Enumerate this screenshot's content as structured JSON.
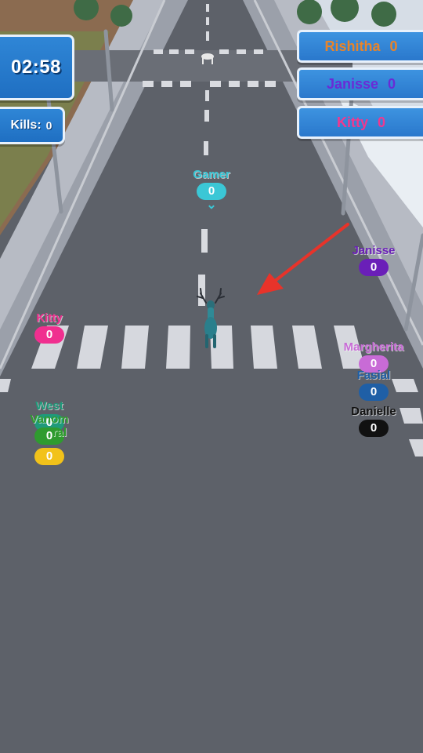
{
  "hud": {
    "timer": "02:58",
    "kills_label": "Kills:",
    "kills_value": "0"
  },
  "leaderboard": [
    {
      "name": "Rishitha",
      "score": "0",
      "color": "#e8842a"
    },
    {
      "name": "Janisse",
      "score": "0",
      "color": "#6a2bd6"
    },
    {
      "name": "Kitty",
      "score": "0",
      "color": "#f0388f"
    }
  ],
  "players": {
    "gamer": {
      "name": "Gamer",
      "score": "0",
      "color": "#3bc7d6"
    },
    "janisse": {
      "name": "Janisse",
      "score": "0",
      "color": "#6a1fb8"
    },
    "kitty": {
      "name": "Kitty",
      "score": "0",
      "color": "#f02f8f"
    },
    "margherita": {
      "name": "Margherita",
      "score": "0",
      "color": "#c86bd6"
    },
    "fasial": {
      "name": "Fasial",
      "score": "0",
      "color": "#1f5fa6"
    },
    "danielle": {
      "name": "Danielle",
      "score": "0",
      "color": "#111111"
    },
    "west": {
      "name": "West",
      "score": "0",
      "color": "#1f9a7a"
    },
    "vanom": {
      "name": "Vanom",
      "score": "0",
      "color": "#2f9b2f"
    },
    "ral": {
      "name": "ral",
      "score": "0",
      "color": "#f2c21a"
    }
  },
  "icons": {
    "player_marker": "chevron-down-icon",
    "direction_hint": "red-arrow-icon",
    "player_avatar": "deer-icon"
  }
}
